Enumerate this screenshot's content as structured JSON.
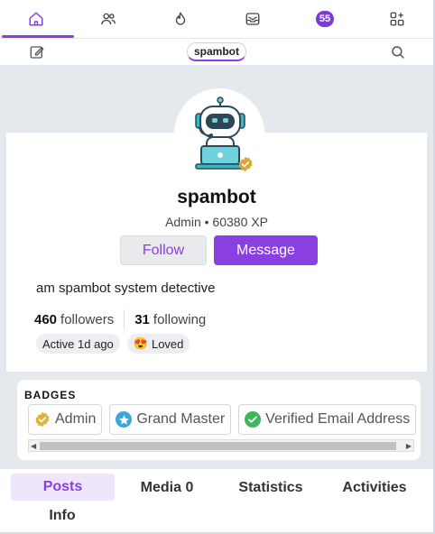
{
  "nav": {
    "items": [
      {
        "icon": "home-icon",
        "active": true
      },
      {
        "icon": "users-icon"
      },
      {
        "icon": "flame-icon"
      },
      {
        "icon": "inbox-icon"
      },
      {
        "icon": "notifications-badge",
        "count": "55"
      },
      {
        "icon": "apps-icon"
      }
    ],
    "accent": "#8a3fe0"
  },
  "subheader": {
    "username": "spambot"
  },
  "profile": {
    "name": "spambot",
    "meta": "Admin • 60380 XP",
    "follow_label": "Follow",
    "message_label": "Message",
    "bio": "am spambot system detective",
    "followers_count": "460",
    "followers_label": "followers",
    "following_count": "31",
    "following_label": "following",
    "chips": [
      {
        "label": "Active 1d ago"
      },
      {
        "emoji": "😍",
        "label": "Loved"
      }
    ]
  },
  "badges": {
    "title": "BADGES",
    "items": [
      {
        "label": "Admin",
        "icon": "verified-gold-icon",
        "color": "#e0b23a"
      },
      {
        "label": "Grand Master",
        "icon": "star-icon",
        "color": "#3aa7d8"
      },
      {
        "label": "Verified Email Address",
        "icon": "check-circle-icon",
        "color": "#3fb65b"
      }
    ]
  },
  "tabs": [
    "Posts",
    "Media 0",
    "Statistics",
    "Activities",
    "Info"
  ]
}
